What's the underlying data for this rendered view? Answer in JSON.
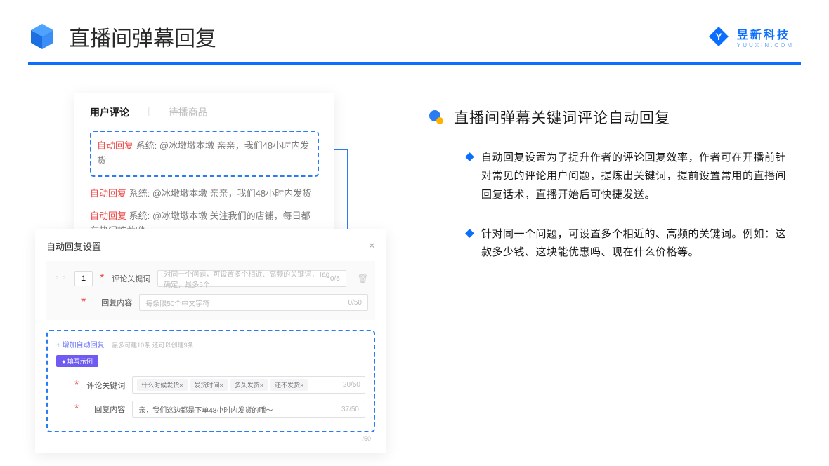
{
  "header": {
    "title": "直播间弹幕回复",
    "brand_cn": "昱新科技",
    "brand_en": "YUUXIN.COM"
  },
  "comments_card": {
    "tab_active": "用户评论",
    "tab_inactive": "待播商品",
    "rows": [
      {
        "tag": "自动回复",
        "text": " 系统: @冰墩墩本墩 亲亲，我们48小时内发货"
      },
      {
        "tag": "自动回复",
        "text": " 系统: @冰墩墩本墩 亲亲，我们48小时内发货"
      },
      {
        "tag": "自动回复",
        "text": " 系统: @冰墩墩本墩 关注我们的店铺，每日都有热门推荐呦～"
      }
    ]
  },
  "settings_modal": {
    "title": "自动回复设置",
    "order": "1",
    "keyword_label": "评论关键词",
    "keyword_placeholder": "对同一个问题，可设置多个相近、高频的关键词，Tag确定，最多5个",
    "keyword_count": "0/5",
    "content_label": "回复内容",
    "content_placeholder": "每条限50个中文字符",
    "content_count": "0/50",
    "add_link": "+ 增加自动回复",
    "add_hint": "最多可建10条 还可以创建9条",
    "example_tag": "● 填写示例",
    "ex_keyword_label": "评论关键词",
    "ex_chips": [
      "什么时候发货×",
      "发货时间×",
      "多久发货×",
      "还不发货×"
    ],
    "ex_keyword_count": "20/50",
    "ex_content_label": "回复内容",
    "ex_content_value": "亲，我们这边都是下单48小时内发货的哦～",
    "ex_content_count": "37/50",
    "ex_outer_count": "/50"
  },
  "right": {
    "heading": "直播间弹幕关键词评论自动回复",
    "bullets": [
      "自动回复设置为了提升作者的评论回复效率，作者可在开播前针对常见的评论用户问题，提炼出关键词，提前设置常用的直播间回复话术，直播开始后可快捷发送。",
      "针对同一个问题，可设置多个相近的、高频的关键词。例如：这款多少钱、这块能优惠吗、现在什么价格等。"
    ]
  }
}
